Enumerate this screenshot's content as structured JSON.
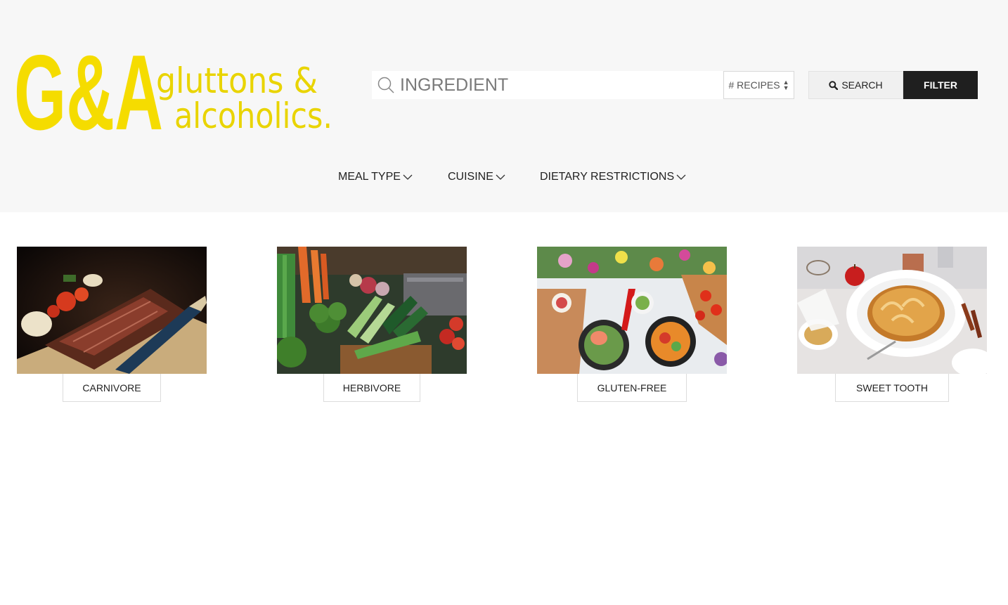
{
  "brand": {
    "monogram": "G&A",
    "line1": "gluttons &",
    "line2": "alcoholics.",
    "color": "#f5dc00"
  },
  "search": {
    "placeholder": "INGREDIENT",
    "value": "",
    "recipes_select": "# RECIPES",
    "search_label": "SEARCH",
    "filter_label": "FILTER"
  },
  "nav": {
    "items": [
      {
        "label": "MEAL TYPE"
      },
      {
        "label": "CUISINE"
      },
      {
        "label": "DIETARY RESTRICTIONS"
      }
    ]
  },
  "categories": [
    {
      "label": "CARNIVORE"
    },
    {
      "label": "HERBIVORE"
    },
    {
      "label": "GLUTEN-FREE"
    },
    {
      "label": "SWEET TOOTH"
    }
  ]
}
